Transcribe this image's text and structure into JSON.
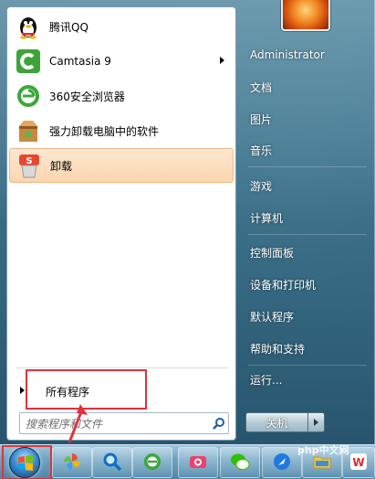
{
  "apps": [
    {
      "label": "腾讯QQ",
      "icon": "qq-penguin-icon",
      "has_submenu": false
    },
    {
      "label": "Camtasia 9",
      "icon": "camtasia-icon",
      "has_submenu": true
    },
    {
      "label": "360安全浏览器",
      "icon": "360-browser-icon",
      "has_submenu": false
    },
    {
      "label": "强力卸载电脑中的软件",
      "icon": "uninstall-box-icon",
      "has_submenu": false
    },
    {
      "label": "卸载",
      "icon": "sogou-uninstall-icon",
      "has_submenu": false,
      "highlighted": true
    }
  ],
  "all_programs": "所有程序",
  "search": {
    "placeholder": "搜索程序和文件"
  },
  "right_menu": [
    {
      "label": "Administrator"
    },
    {
      "label": "文档"
    },
    {
      "label": "图片"
    },
    {
      "label": "音乐"
    },
    {
      "label": "游戏"
    },
    {
      "label": "计算机"
    },
    {
      "label": "控制面板"
    },
    {
      "label": "设备和打印机"
    },
    {
      "label": "默认程序"
    },
    {
      "label": "帮助和支持"
    },
    {
      "label": "运行..."
    }
  ],
  "shutdown": {
    "label": "关机"
  },
  "taskbar": {
    "items": [
      "start-orb-icon",
      "pinwheel-icon",
      "magnifier-icon",
      "360-browser-icon",
      "camera-app-icon",
      "wechat-icon",
      "feather-app-icon",
      "folder-icon",
      "wps-icon"
    ]
  },
  "watermark": "php中文网",
  "colors": {
    "highlight": "#fcd6b0",
    "annotation_red": "#e0323a"
  }
}
